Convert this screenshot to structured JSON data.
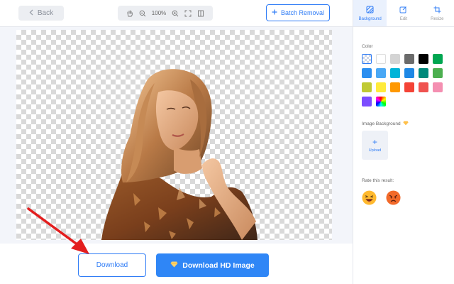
{
  "toolbar": {
    "back_label": "Back",
    "zoom_level": "100%",
    "batch_label": "Batch Removal"
  },
  "bottom": {
    "download_label": "Download",
    "hd_label": "Download HD Image"
  },
  "panel": {
    "tabs": [
      {
        "label": "Background",
        "icon": "background-icon",
        "active": true
      },
      {
        "label": "Edit",
        "icon": "edit-icon",
        "active": false
      },
      {
        "label": "Resize",
        "icon": "crop-icon",
        "active": false
      }
    ],
    "color_label": "Color",
    "colors": [
      "transparent",
      "#ffffff",
      "#d4d4d4",
      "#6b6b6b",
      "#000000",
      "#00a651",
      "#2b8ff0",
      "#4aa8f5",
      "#00b4d8",
      "#1e88e5",
      "#00897b",
      "#4caf50",
      "#c0ca33",
      "#ffeb3b",
      "#ff9800",
      "#f44336",
      "#ef5350",
      "#f48fb1",
      "#7c4dff",
      "rainbow"
    ],
    "image_bg_label": "Image Background",
    "upload_label": "Upload",
    "rate_label": "Rate this result:",
    "rate_options": [
      "laughing-emoji-icon",
      "angry-emoji-icon"
    ]
  }
}
